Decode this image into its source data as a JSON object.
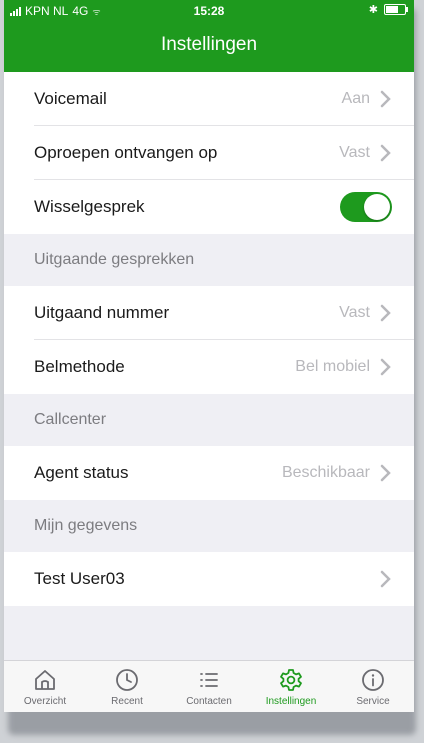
{
  "statusbar": {
    "carrier": "KPN NL",
    "network": "4G",
    "time": "15:28"
  },
  "header": {
    "title": "Instellingen"
  },
  "rows_top": [
    {
      "label": "Voicemail",
      "value": "Aan"
    },
    {
      "label": "Oproepen ontvangen op",
      "value": "Vast"
    },
    {
      "label": "Wisselgesprek",
      "toggle": true
    }
  ],
  "sections": {
    "outgoing": "Uitgaande gesprekken",
    "callcenter": "Callcenter",
    "mydata": "Mijn gegevens"
  },
  "rows_outgoing": [
    {
      "label": "Uitgaand nummer",
      "value": "Vast"
    },
    {
      "label": "Belmethode",
      "value": "Bel mobiel"
    }
  ],
  "rows_callcenter": [
    {
      "label": "Agent status",
      "value": "Beschikbaar"
    }
  ],
  "rows_mydata": [
    {
      "label": "Test User03"
    }
  ],
  "tabs": [
    {
      "label": "Overzicht",
      "icon": "home-icon"
    },
    {
      "label": "Recent",
      "icon": "clock-icon"
    },
    {
      "label": "Contacten",
      "icon": "list-icon"
    },
    {
      "label": "Instellingen",
      "icon": "gear-icon",
      "active": true
    },
    {
      "label": "Service",
      "icon": "info-icon"
    }
  ],
  "colors": {
    "brand": "#1e9a1e",
    "secondary_text": "#b8b8bc",
    "section_text": "#7c7c80"
  }
}
